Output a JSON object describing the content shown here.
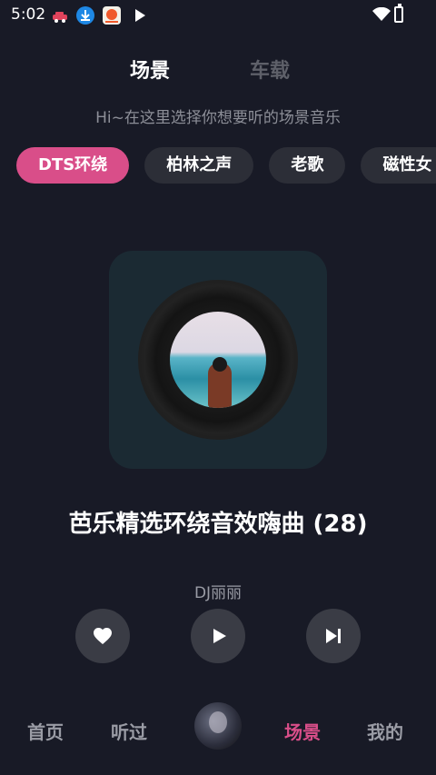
{
  "status_bar": {
    "time": "5:02",
    "icons": [
      "car-notification-icon",
      "download-icon",
      "app-notification-icon",
      "play-store-icon"
    ]
  },
  "header": {
    "tabs": [
      {
        "label": "场景",
        "active": true
      },
      {
        "label": "车载",
        "active": false
      }
    ],
    "subtitle": "Hi~在这里选择你想要听的场景音乐"
  },
  "categories": [
    {
      "label": "DTS环绕",
      "active": true
    },
    {
      "label": "柏林之声",
      "active": false
    },
    {
      "label": "老歌",
      "active": false
    },
    {
      "label": "磁性女",
      "active": false
    }
  ],
  "player": {
    "title": "芭乐精选环绕音效嗨曲 (28)",
    "artist": "DJ丽丽",
    "controls": [
      "favorite-icon",
      "play-icon",
      "next-icon"
    ]
  },
  "bottom_nav": {
    "items": [
      {
        "label": "首页",
        "active": false
      },
      {
        "label": "听过",
        "active": false
      },
      {
        "label": "场景",
        "active": true
      },
      {
        "label": "我的",
        "active": false
      }
    ]
  },
  "colors": {
    "accent": "#d94e89",
    "background": "#181a26",
    "chip": "#2c2e37"
  }
}
